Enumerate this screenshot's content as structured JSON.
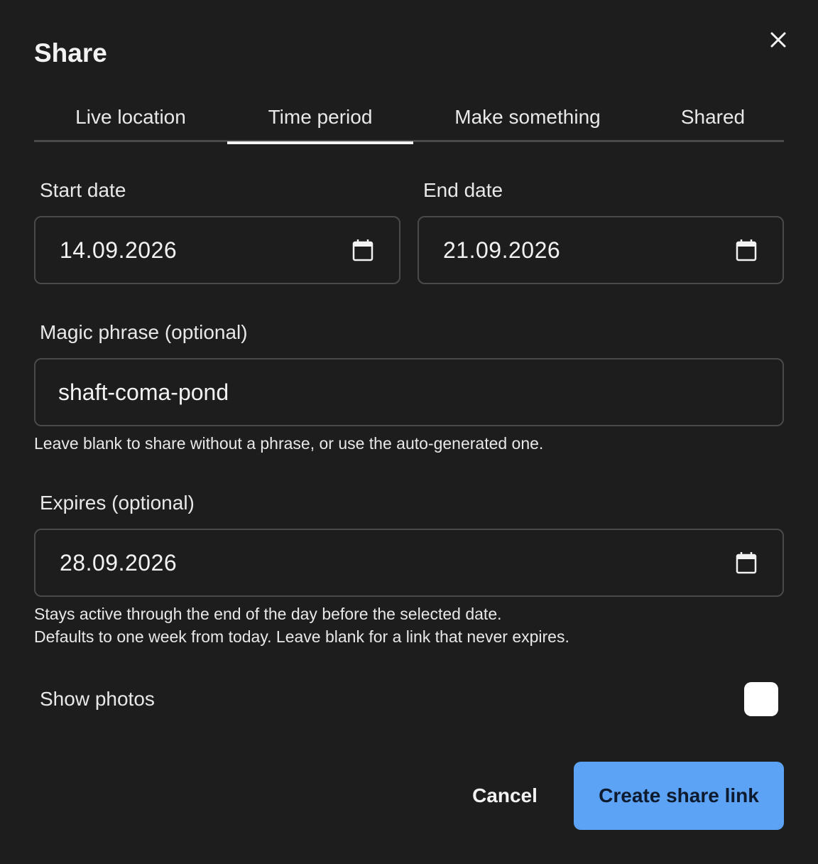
{
  "dialog": {
    "title": "Share",
    "close_icon": "close-icon"
  },
  "tabs": [
    {
      "label": "Live location",
      "active": false
    },
    {
      "label": "Time period",
      "active": true
    },
    {
      "label": "Make something",
      "active": false
    },
    {
      "label": "Shared",
      "active": false
    }
  ],
  "start_date": {
    "label": "Start date",
    "value": "14.09.2026",
    "icon": "calendar-icon"
  },
  "end_date": {
    "label": "End date",
    "value": "21.09.2026",
    "icon": "calendar-icon"
  },
  "magic_phrase": {
    "label": "Magic phrase (optional)",
    "value": "shaft-coma-pond",
    "help": "Leave blank to share without a phrase, or use the auto-generated one."
  },
  "expires": {
    "label": "Expires (optional)",
    "value": "28.09.2026",
    "icon": "calendar-icon",
    "help_line1": "Stays active through the end of the day before the selected date.",
    "help_line2": "Defaults to one week from today. Leave blank for a link that never expires."
  },
  "show_photos": {
    "label": "Show photos",
    "checked": false
  },
  "actions": {
    "cancel_label": "Cancel",
    "create_label": "Create share link",
    "primary_color": "#5ca2f5"
  }
}
